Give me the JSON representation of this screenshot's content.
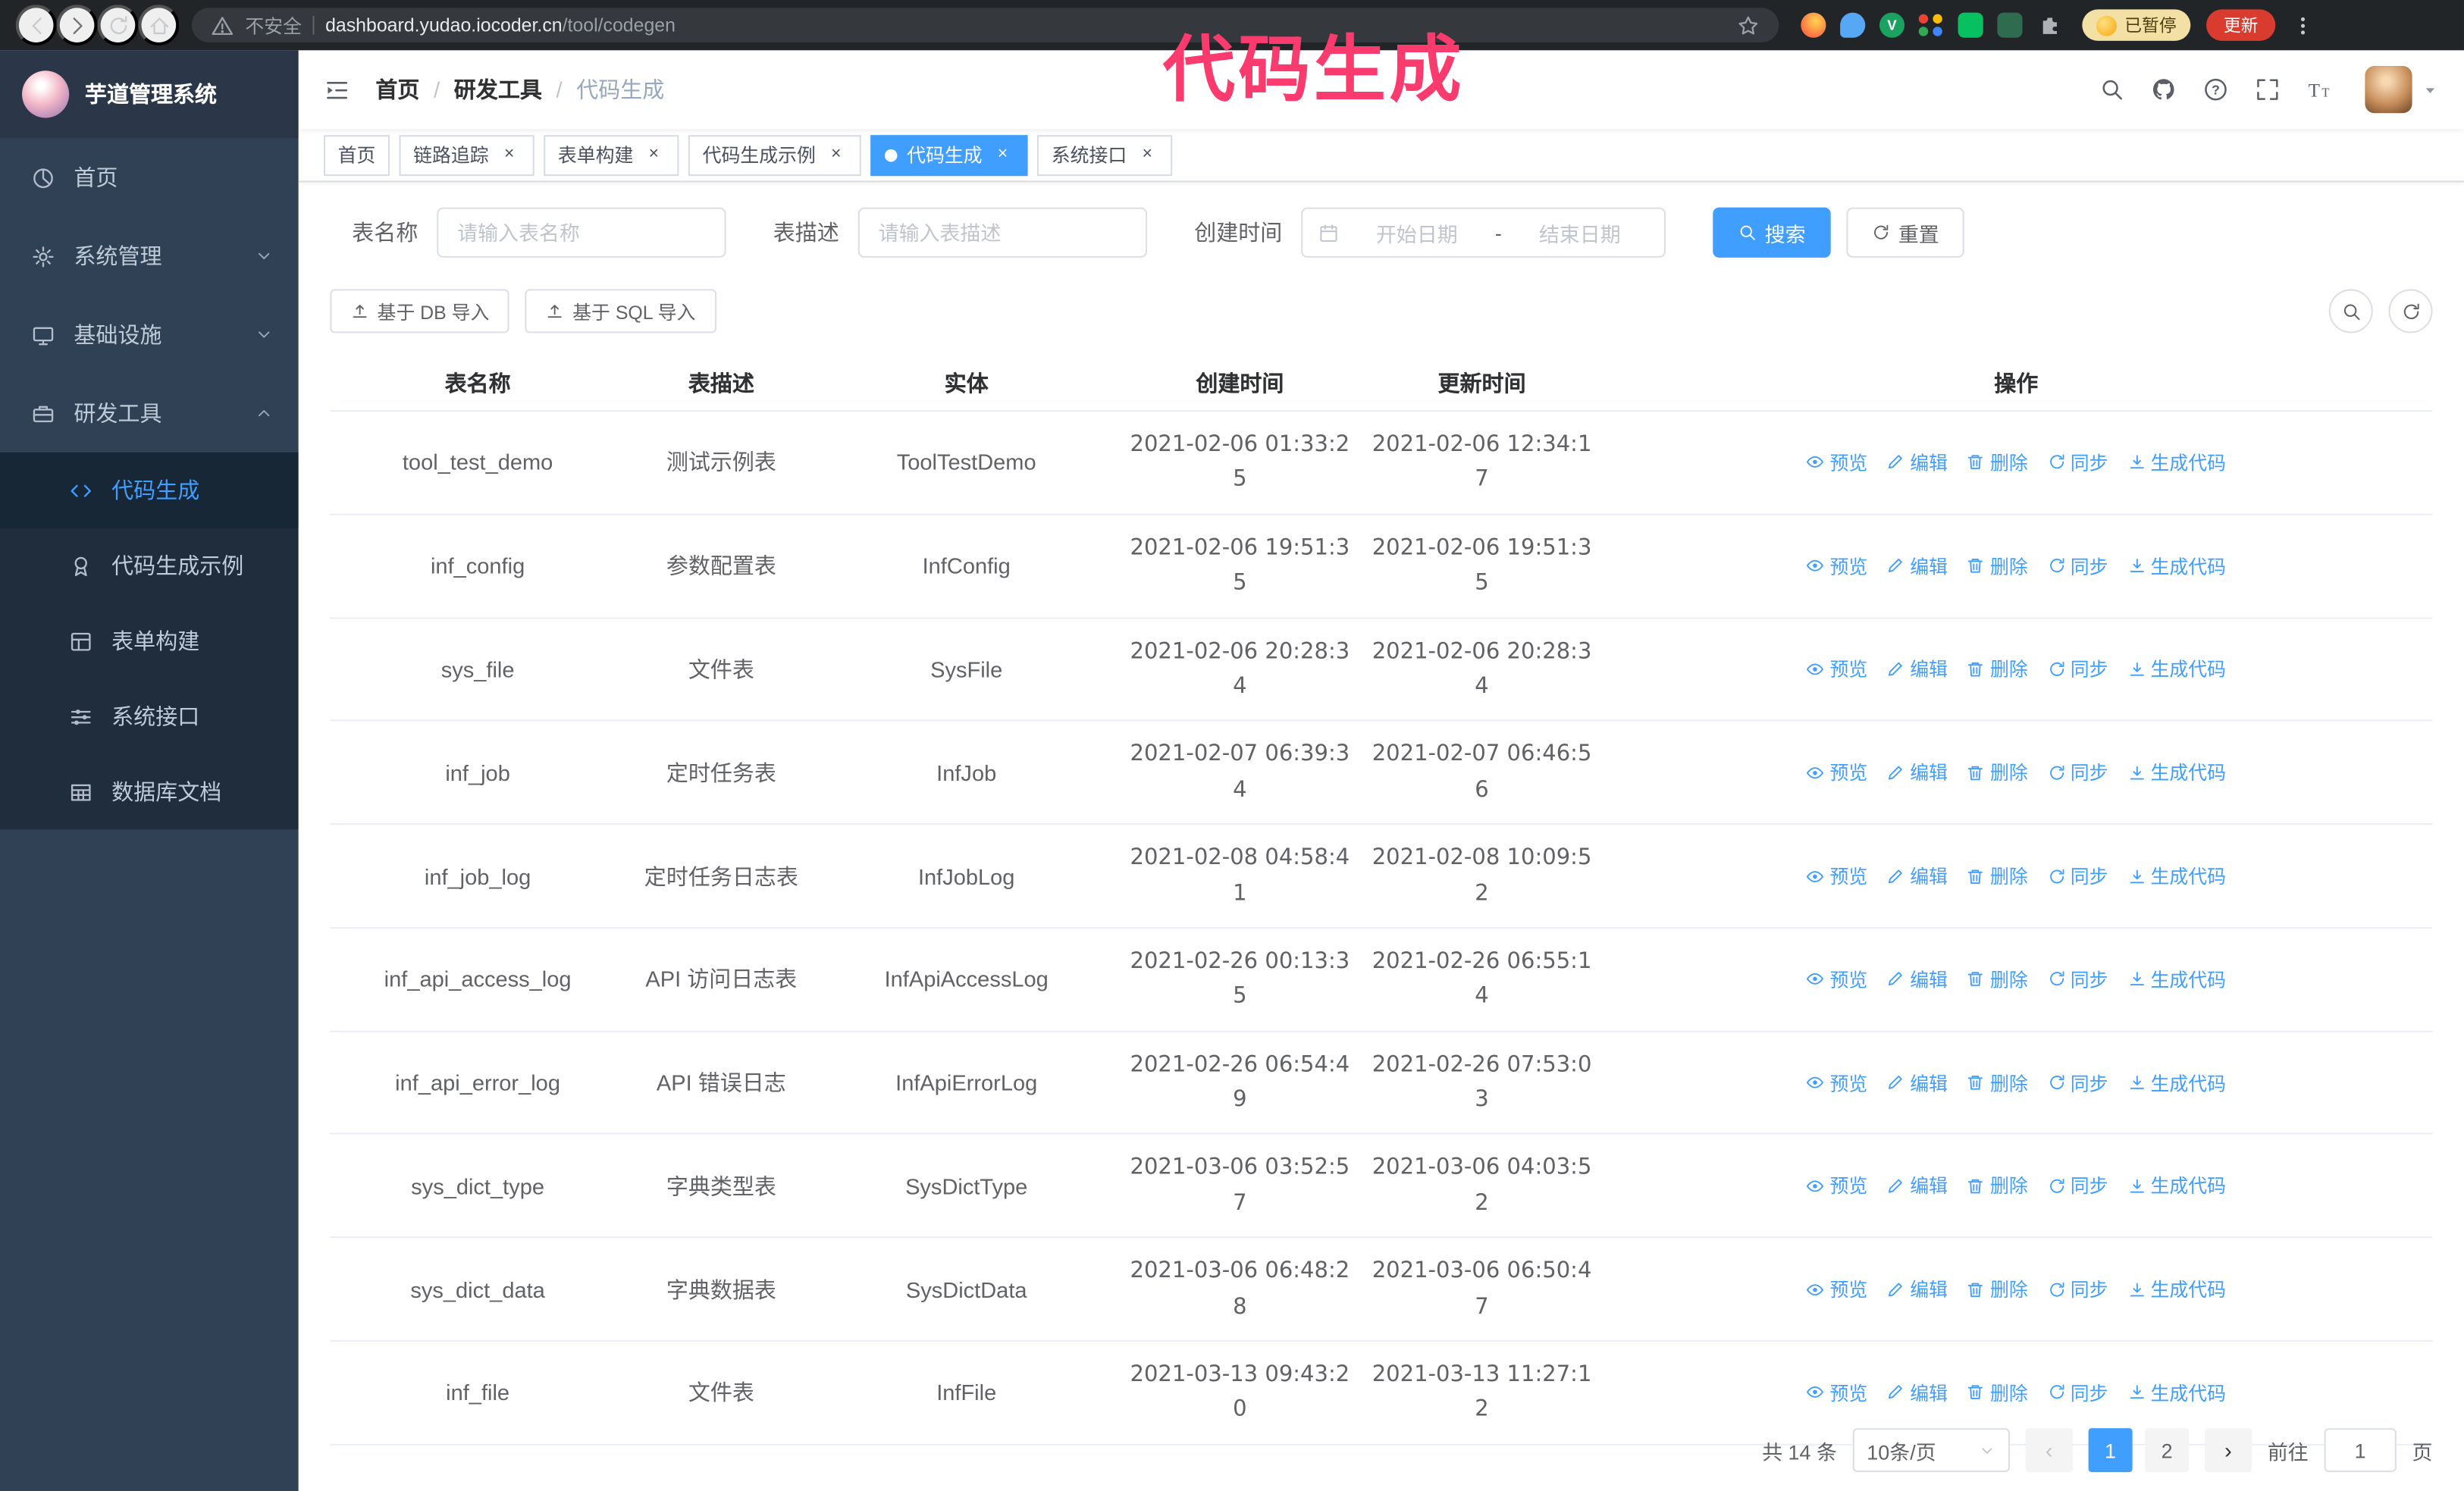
{
  "colors": {
    "primary": "#409eff",
    "annotation": "#fb3a6e"
  },
  "browser": {
    "security_label": "不安全",
    "url_domain": "dashboard.yudao.iocoder.cn",
    "url_path": "/tool/codegen",
    "paused_badge": "已暂停",
    "update_button": "更新"
  },
  "annotation": {
    "text": "代码生成"
  },
  "sidebar": {
    "title": "芋道管理系统",
    "items": [
      {
        "id": "home",
        "icon": "dashboard",
        "label": "首页"
      },
      {
        "id": "system",
        "icon": "gear",
        "label": "系统管理",
        "group": true,
        "expanded": false
      },
      {
        "id": "infra",
        "icon": "monitor",
        "label": "基础设施",
        "group": true,
        "expanded": false
      },
      {
        "id": "devtools",
        "icon": "toolbox",
        "label": "研发工具",
        "group": true,
        "expanded": true,
        "children": [
          {
            "id": "codegen",
            "icon": "code",
            "label": "代码生成",
            "active": true
          },
          {
            "id": "codegen-example",
            "icon": "medal",
            "label": "代码生成示例"
          },
          {
            "id": "form-build",
            "icon": "form-grid",
            "label": "表单构建"
          },
          {
            "id": "system-api",
            "icon": "sliders",
            "label": "系统接口"
          },
          {
            "id": "db-doc",
            "icon": "table",
            "label": "数据库文档"
          }
        ]
      }
    ]
  },
  "navbar": {
    "breadcrumb": [
      "首页",
      "研发工具",
      "代码生成"
    ]
  },
  "tabs": [
    {
      "id": "home",
      "label": "首页",
      "closable": false,
      "active": false
    },
    {
      "id": "trace",
      "label": "链路追踪",
      "closable": true,
      "active": false
    },
    {
      "id": "form-build",
      "label": "表单构建",
      "closable": true,
      "active": false
    },
    {
      "id": "codegen-example",
      "label": "代码生成示例",
      "closable": true,
      "active": false
    },
    {
      "id": "codegen",
      "label": "代码生成",
      "closable": true,
      "active": true
    },
    {
      "id": "system-api",
      "label": "系统接口",
      "closable": true,
      "active": false
    }
  ],
  "filters": {
    "table_name_label": "表名称",
    "table_name_placeholder": "请输入表名称",
    "table_desc_label": "表描述",
    "table_desc_placeholder": "请输入表描述",
    "create_time_label": "创建时间",
    "date_start_placeholder": "开始日期",
    "date_separator": "-",
    "date_end_placeholder": "结束日期",
    "search_button": "搜索",
    "reset_button": "重置"
  },
  "toolbar": {
    "import_db_button": "基于 DB 导入",
    "import_sql_button": "基于 SQL 导入"
  },
  "table": {
    "columns": [
      "表名称",
      "表描述",
      "实体",
      "创建时间",
      "更新时间",
      "操作"
    ],
    "op_labels": [
      "预览",
      "编辑",
      "删除",
      "同步",
      "生成代码"
    ],
    "op_icons": [
      "eye",
      "edit",
      "delete",
      "sync",
      "download"
    ],
    "op_ids": [
      "preview",
      "edit",
      "delete",
      "sync",
      "generate"
    ],
    "rows": [
      {
        "name": "tool_test_demo",
        "desc": "测试示例表",
        "entity": "ToolTestDemo",
        "created": "2021-02-06 01:33:25",
        "updated": "2021-02-06 12:34:17"
      },
      {
        "name": "inf_config",
        "desc": "参数配置表",
        "entity": "InfConfig",
        "created": "2021-02-06 19:51:35",
        "updated": "2021-02-06 19:51:35"
      },
      {
        "name": "sys_file",
        "desc": "文件表",
        "entity": "SysFile",
        "created": "2021-02-06 20:28:34",
        "updated": "2021-02-06 20:28:34"
      },
      {
        "name": "inf_job",
        "desc": "定时任务表",
        "entity": "InfJob",
        "created": "2021-02-07 06:39:34",
        "updated": "2021-02-07 06:46:56"
      },
      {
        "name": "inf_job_log",
        "desc": "定时任务日志表",
        "entity": "InfJobLog",
        "created": "2021-02-08 04:58:41",
        "updated": "2021-02-08 10:09:52"
      },
      {
        "name": "inf_api_access_log",
        "desc": "API 访问日志表",
        "entity": "InfApiAccessLog",
        "created": "2021-02-26 00:13:35",
        "updated": "2021-02-26 06:55:14"
      },
      {
        "name": "inf_api_error_log",
        "desc": "API 错误日志",
        "entity": "InfApiErrorLog",
        "created": "2021-02-26 06:54:49",
        "updated": "2021-02-26 07:53:03"
      },
      {
        "name": "sys_dict_type",
        "desc": "字典类型表",
        "entity": "SysDictType",
        "created": "2021-03-06 03:52:57",
        "updated": "2021-03-06 04:03:52"
      },
      {
        "name": "sys_dict_data",
        "desc": "字典数据表",
        "entity": "SysDictData",
        "created": "2021-03-06 06:48:28",
        "updated": "2021-03-06 06:50:47"
      },
      {
        "name": "inf_file",
        "desc": "文件表",
        "entity": "InfFile",
        "created": "2021-03-13 09:43:20",
        "updated": "2021-03-13 11:27:12"
      }
    ]
  },
  "pagination": {
    "total_text": "共 14 条",
    "page_size": "10条/页",
    "pages": [
      "1",
      "2"
    ],
    "active_page": "1",
    "goto_label": "前往",
    "goto_value": "1",
    "goto_suffix": "页"
  }
}
